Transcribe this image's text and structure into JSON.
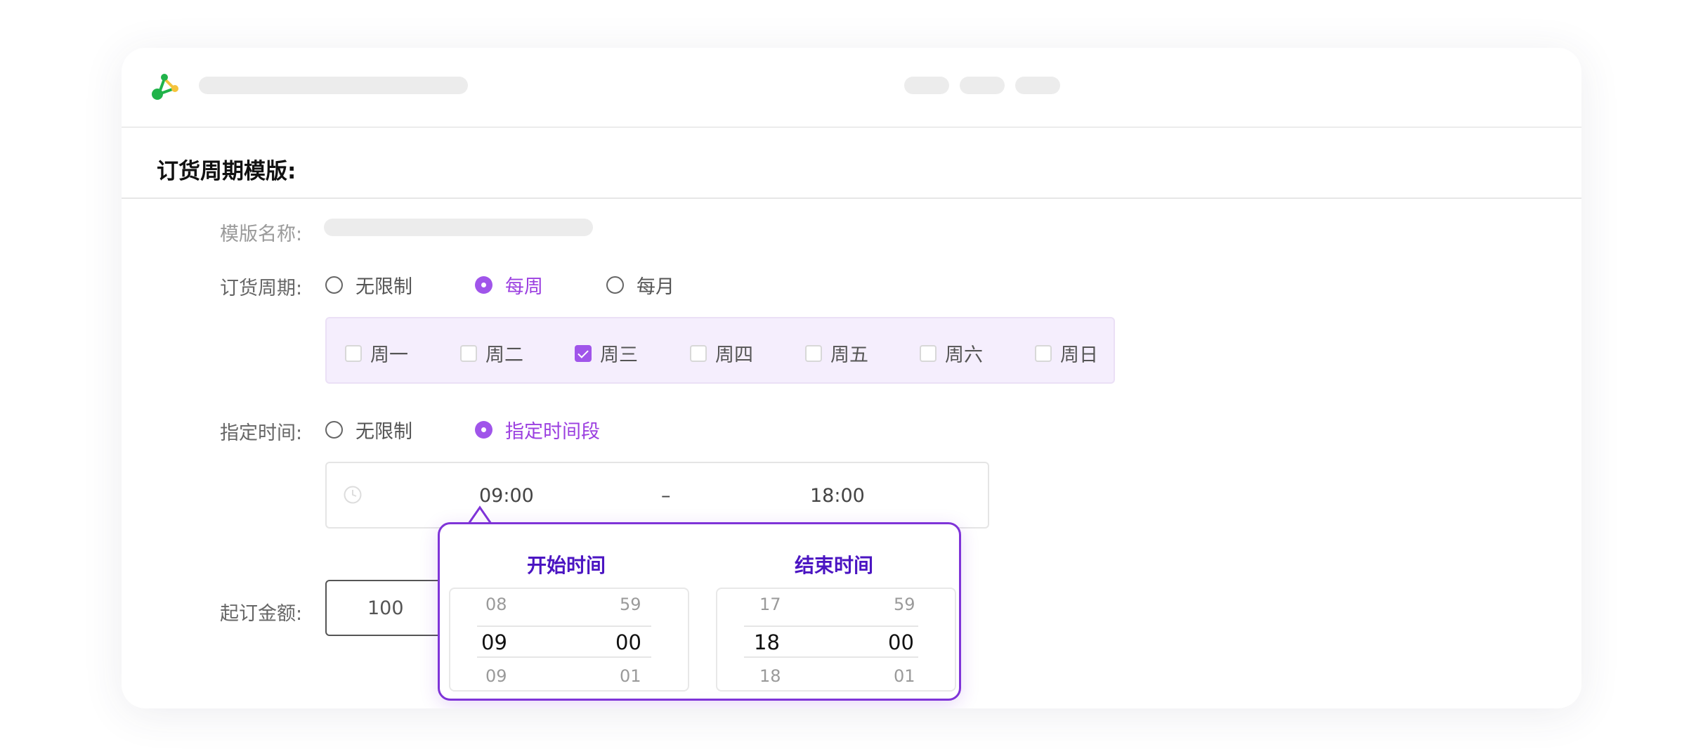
{
  "section_title": "订货周期模版:",
  "template_name": {
    "label": "模版名称:"
  },
  "order_cycle": {
    "label": "订货周期:",
    "options": [
      "无限制",
      "每周",
      "每月"
    ],
    "selected": "每周"
  },
  "weekdays": {
    "days": [
      "周一",
      "周二",
      "周三",
      "周四",
      "周五",
      "周六",
      "周日"
    ],
    "checked": [
      "周三"
    ]
  },
  "specified_time": {
    "label": "指定时间:",
    "options": [
      "无限制",
      "指定时间段"
    ],
    "selected": "指定时间段"
  },
  "time_range": {
    "start": "09:00",
    "separator": "–",
    "end": "18:00"
  },
  "min_amount": {
    "label": "起订金额:",
    "value": "100"
  },
  "picker": {
    "start": {
      "title": "开始时间",
      "hours": [
        "08",
        "09",
        "09"
      ],
      "minutes": [
        "59",
        "00",
        "01"
      ]
    },
    "end": {
      "title": "结束时间",
      "hours": [
        "17",
        "18",
        "18"
      ],
      "minutes": [
        "59",
        "00",
        "01"
      ]
    }
  },
  "colors": {
    "accent": "#a055ea",
    "picker_border": "#7f34d8",
    "picker_title": "#4b15c2",
    "logo_green": "#20b34a",
    "logo_yellow": "#f5c33b"
  },
  "icons": [
    "app-logo-icon",
    "clock-icon",
    "radio-icon",
    "checkbox-icon"
  ]
}
